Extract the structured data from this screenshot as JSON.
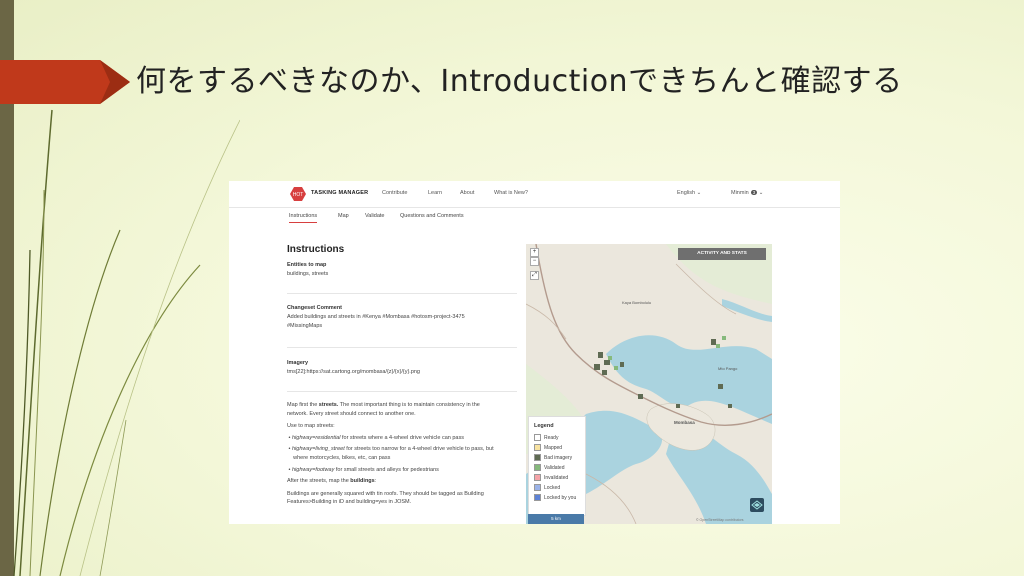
{
  "slide": {
    "title": "何をするべきなのか、Introductionできちんと確認する"
  },
  "app": {
    "brand": "TASKING MANAGER",
    "nav": [
      "Contribute",
      "Learn",
      "About",
      "What is New?"
    ],
    "language": "English",
    "user": "Minmin",
    "user_badge": "3",
    "tabs": [
      "Instructions",
      "Map",
      "Validate",
      "Questions and Comments"
    ],
    "active_tab": "Instructions"
  },
  "instructions": {
    "heading": "Instructions",
    "entities_label": "Entities to map",
    "entities_value": "buildings, streets",
    "changeset_label": "Changeset Comment",
    "changeset_line1": "Added buildings and streets in #Kenya #Mombasa #hotosm-project-3475",
    "changeset_line2": "#MissingMaps",
    "imagery_label": "Imagery",
    "imagery_value": "tms[22]:https://sat.cartong.org/mombasa/{z}/{x}/{y}.png",
    "body1_pre": "Map first the ",
    "body1_bold": "streets.",
    "body1_post": " The most important thing is to maintain consistency in the",
    "body1_line2": "network. Every street should connect to another one.",
    "use_streets": "Use to map streets:",
    "bullet1_key": "highway=residential",
    "bullet1_text": " for streets where a 4-wheel drive vehicle can pass",
    "bullet2_key": "highway=living_street",
    "bullet2_text": " for streets too narrow for a 4-wheel drive vehicle to pass, but",
    "bullet2_line2": "where motorcycles, bikes, etc, can pass",
    "bullet3_key": "highway=footway",
    "bullet3_text": " for small streets and alleys for pedestrians",
    "after_pre": "After the streets, map the ",
    "after_bold": "buildings",
    "after_post": ":",
    "buildings_line1": "Buildings are generally squared with tin roofs. They should be tagged as Building",
    "buildings_line2": "Features>Building in iD and building=yes in JOSM."
  },
  "map": {
    "activity_button": "ACTIVITY AND STATS",
    "zoom_in": "+",
    "zoom_out": "−",
    "places": [
      "Kaya Bombolulu",
      "Mombasa",
      "Mto Pango"
    ],
    "legend_title": "Legend",
    "legend": [
      {
        "label": "Ready",
        "color": "#ffffff"
      },
      {
        "label": "Mapped",
        "color": "#f8e3a1"
      },
      {
        "label": "Bad imagery",
        "color": "#5f6b53"
      },
      {
        "label": "Validated",
        "color": "#86b97c"
      },
      {
        "label": "Invalidated",
        "color": "#f5a3a8"
      },
      {
        "label": "Locked",
        "color": "#9bb3e8"
      },
      {
        "label": "Locked by you",
        "color": "#5e83d6"
      }
    ],
    "scale": "5 km",
    "attribution": "© OpenStreetMap contributors"
  },
  "colors": {
    "accent_red": "#c0391b",
    "sidebar": "#6b6645",
    "water": "#aad3df"
  }
}
